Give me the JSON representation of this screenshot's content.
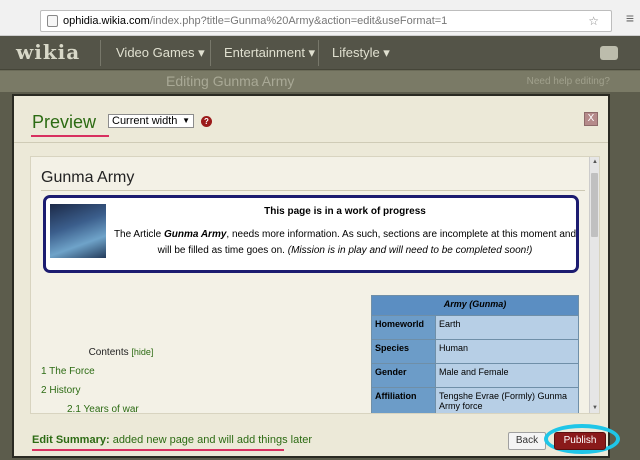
{
  "browser": {
    "url_host": "ophidia.wikia.com",
    "url_path": "/index.php?title=Gunma%20Army&action=edit&useFormat=1"
  },
  "wikia_header": {
    "logo": "wikia",
    "nav": [
      "Video Games ▾",
      "Entertainment ▾",
      "Lifestyle ▾"
    ],
    "editing_label": "Editing Gunma Army",
    "need_help": "Need help editing?"
  },
  "modal": {
    "title": "Preview",
    "width_option": "Current width",
    "help_glyph": "?",
    "close_glyph": "X"
  },
  "article": {
    "title": "Gunma Army",
    "notice_title": "This page is in a work of progress",
    "notice_pre": "The Article ",
    "notice_name": "Gunma Army",
    "notice_mid": ", needs more information. As such, sections are incomplete at this moment and will be filled as time goes on. ",
    "notice_italic": "(Mission is in play and will need to be completed soon!)",
    "infobox": {
      "title": "Army (Gunma)",
      "rows": [
        {
          "key": "Homeworld",
          "value": "Earth"
        },
        {
          "key": "Species",
          "value": "Human"
        },
        {
          "key": "Gender",
          "value": "Male and Female"
        },
        {
          "key": "Affiliation",
          "value": "Tengshe Evrae (Formly) Gunma Army force"
        }
      ]
    },
    "toc": {
      "title": "Contents",
      "hide": "[hide]",
      "items": [
        {
          "num": "1",
          "label": "The Force"
        },
        {
          "num": "2",
          "label": "History"
        },
        {
          "num": "2.1",
          "label": "Years of war"
        }
      ]
    }
  },
  "footer": {
    "summary_label": "Edit Summary:",
    "summary_text": " added new page and will add things later",
    "back": "Back",
    "publish": "Publish"
  }
}
